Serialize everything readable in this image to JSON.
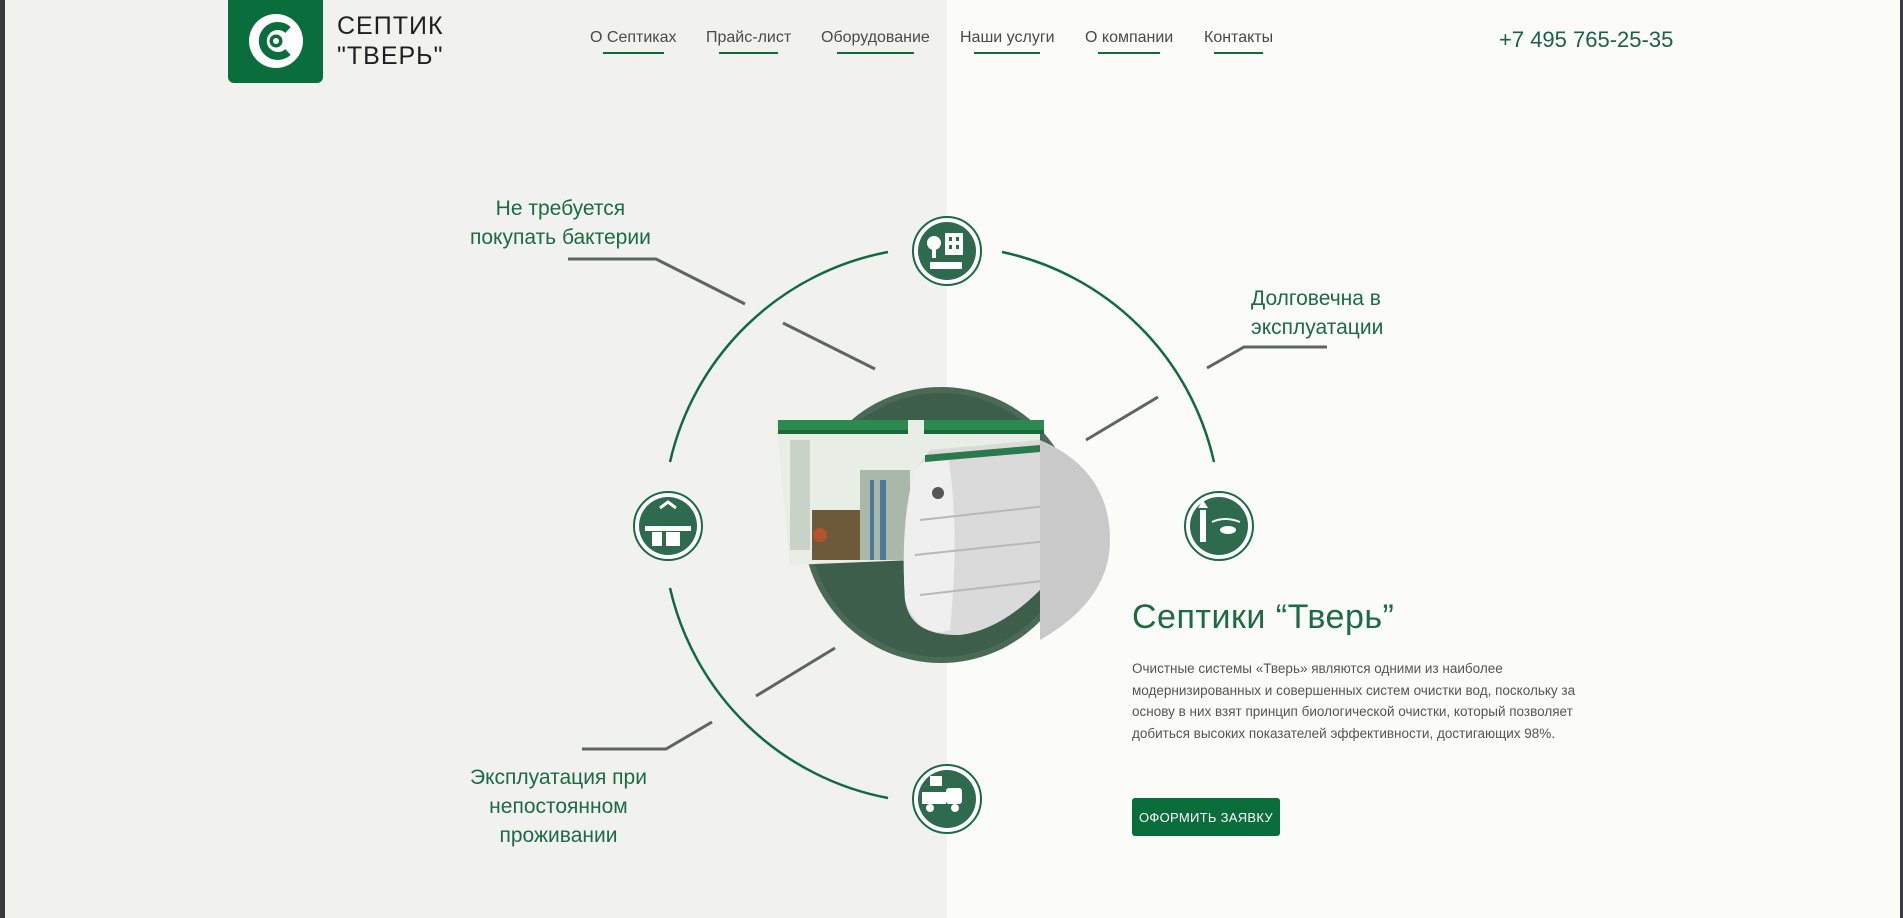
{
  "header": {
    "brand_line1": "СЕПТИК",
    "brand_line2": "\"ТВЕРЬ\"",
    "nav": [
      {
        "label": "О Септиках"
      },
      {
        "label": "Прайс-лист"
      },
      {
        "label": "Оборудование"
      },
      {
        "label": "Наши услуги"
      },
      {
        "label": "О компании"
      },
      {
        "label": "Контакты"
      }
    ],
    "phone": "+7 495 765-25-35"
  },
  "features": {
    "top_left": {
      "line1": "Не требуется",
      "line2": "покупать бактерии"
    },
    "top_right": {
      "line1": "Долговечна в",
      "line2": "эксплуатации"
    },
    "bottom_left": {
      "line1": "Эксплуатация при",
      "line2": "непостоянном",
      "line3": "проживании"
    }
  },
  "product": {
    "title": "Септики “Тверь”",
    "description": "Очистные системы «Тверь» являются одними из наиболее модернизированных и совершенных систем очистки вод, поскольку за основу в них взят принцип биологической очистки, который позволяет добиться высоких показателей эффективности, достигающих 98%.",
    "button_label": "ОФОРМИТЬ ЗАЯВКУ"
  },
  "icons": [
    "logo-icon",
    "house-icon",
    "septic-tank-icon",
    "fish-pond-icon",
    "service-truck-icon"
  ],
  "colors": {
    "accent": "#0a6e3c",
    "text_green": "#1b6b45",
    "bg_left": "#f1f1ee",
    "bg_right": "#fbfcf8"
  }
}
